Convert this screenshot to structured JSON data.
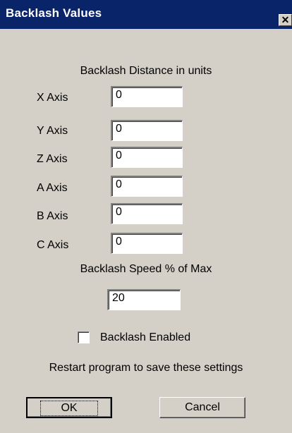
{
  "window": {
    "title": "Backlash Values",
    "close_glyph": "✕"
  },
  "section": {
    "heading": "Backlash Distance in units"
  },
  "axes": [
    {
      "label": "X Axis",
      "value": "0"
    },
    {
      "label": "Y Axis",
      "value": "0"
    },
    {
      "label": "Z Axis",
      "value": "0"
    },
    {
      "label": "A Axis",
      "value": "0"
    },
    {
      "label": "B Axis",
      "value": "0"
    },
    {
      "label": "C Axis",
      "value": "0"
    }
  ],
  "speed": {
    "label": "Backlash Speed % of Max",
    "value": "20"
  },
  "enabled": {
    "label": "Backlash Enabled",
    "checked": false
  },
  "note": "Restart program to save these settings",
  "buttons": {
    "ok": "OK",
    "cancel": "Cancel"
  },
  "colors": {
    "titlebar": "#0a246a",
    "face": "#d4d0c8"
  }
}
